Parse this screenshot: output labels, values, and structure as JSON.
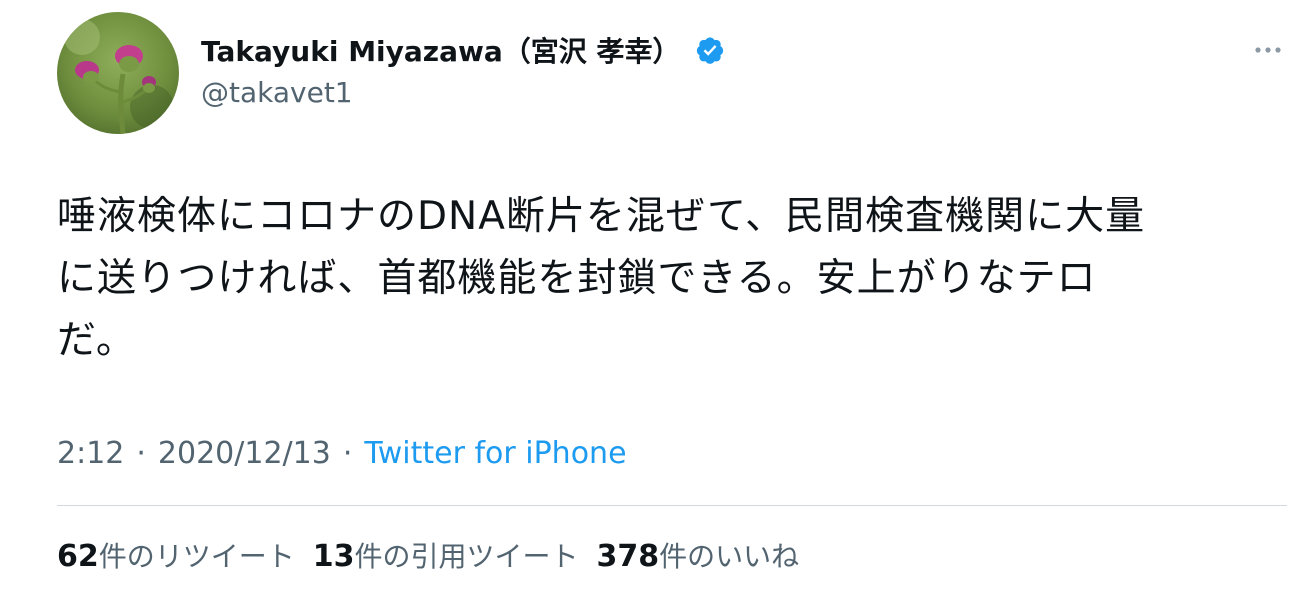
{
  "user": {
    "display_name": "Takayuki Miyazawa（宮沢 孝幸）",
    "handle": "@takavet1",
    "verified": true,
    "avatar_icon": "thistle-flower-avatar"
  },
  "tweet": {
    "text": "唾液検体にコロナのDNA断片を混ぜて、民間検査機関に大量\nに送りつければ、首都機能を封鎖できる。安上がりなテロ\nだ。",
    "time": "2:12",
    "date": "2020/12/13",
    "separator": "·",
    "source": "Twitter for iPhone"
  },
  "stats": {
    "retweets_count": "62",
    "retweets_label": "件のリツイート",
    "quotes_count": "13",
    "quotes_label": "件の引用ツイート",
    "likes_count": "378",
    "likes_label": "件のいいね"
  },
  "colors": {
    "text": "#0f1419",
    "secondary": "#536471",
    "link": "#1d9bf0",
    "verified": "#1d9bf0",
    "divider": "#cfd9de"
  },
  "icons": {
    "more": "more-horizontal-icon",
    "verified": "verified-badge-icon"
  }
}
